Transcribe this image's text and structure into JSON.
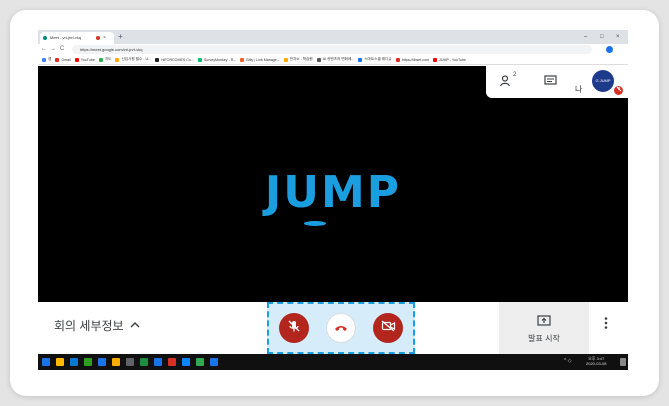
{
  "browser": {
    "tab_title": "Meet - vri-jnrf-vkq",
    "url": "https://meet.google.com/vri-jnrf-vkq",
    "new_tab": "+",
    "tab_close": "×",
    "window_controls": [
      "–",
      "□",
      "×"
    ],
    "nav": [
      "←",
      "→",
      "C"
    ],
    "bookmarks": [
      {
        "label": "앱",
        "color": "#4285f4"
      },
      {
        "label": "Gmail",
        "color": "#d93025"
      },
      {
        "label": "YouTube",
        "color": "#ff0000"
      },
      {
        "label": "지도",
        "color": "#34a853"
      },
      {
        "label": "신입사원 필수 - U...",
        "color": "#f9ab00"
      },
      {
        "label": "HiFORCOMES Co...",
        "color": "#222222"
      },
      {
        "label": "SurveyMonkey - R...",
        "color": "#00bf6f"
      },
      {
        "label": "Bitly | Link Manage...",
        "color": "#ee6123"
      },
      {
        "label": "전자소 - 학습원",
        "color": "#f9ab00"
      },
      {
        "label": "AI 컨텐츠의 변화에...",
        "color": "#555555"
      },
      {
        "label": "스마트스쿨 레디슈",
        "color": "#1a73e8"
      },
      {
        "label": "https://dbset.com",
        "color": "#d93025"
      },
      {
        "label": "JUMP - YouTube",
        "color": "#ff0000"
      }
    ]
  },
  "meeting": {
    "logo_text": "JUMP",
    "participants_count": "2",
    "self_label": "나",
    "avatar_text": "G JUMP",
    "details_label": "회의 세부정보",
    "present_label": "발표 시작",
    "controls": [
      "mic-off",
      "hangup",
      "camera-off"
    ]
  },
  "taskbar": {
    "time": "오후 3:47",
    "date": "2020-03-08"
  },
  "colors": {
    "accent": "#1a9ee0",
    "control_red": "#b3261e",
    "highlight_fill": "#d6ecfa"
  }
}
